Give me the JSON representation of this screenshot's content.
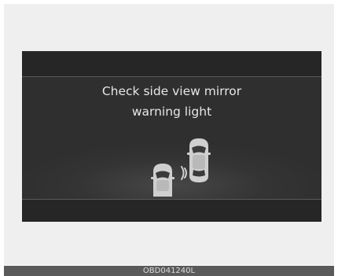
{
  "display": {
    "message_line1": "Check side view mirror",
    "message_line2": "warning light",
    "illustration_icon": "blind-spot-warning-cars-icon"
  },
  "footer": {
    "code": "OBD041240L"
  },
  "colors": {
    "screen_background": "#2b2b2b",
    "text": "#e6e6e6",
    "car_body": "#cfcfcf",
    "footer_bar": "#5a5a5a"
  }
}
